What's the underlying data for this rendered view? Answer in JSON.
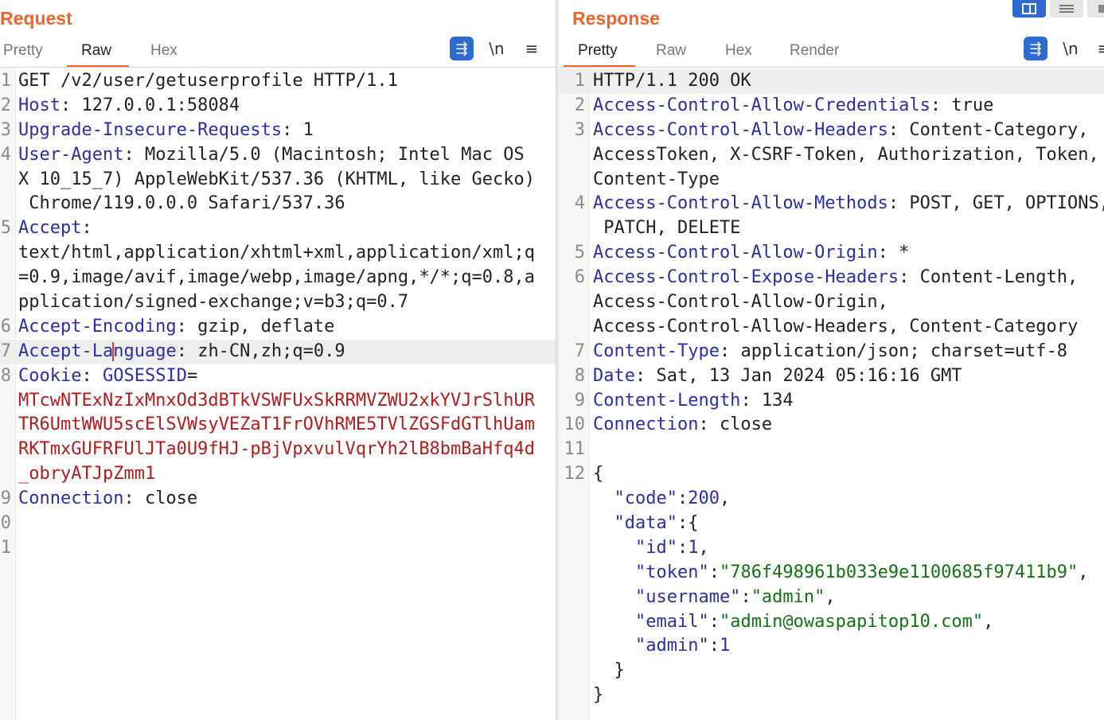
{
  "request": {
    "title": "Request",
    "tabs": [
      "Pretty",
      "Raw",
      "Hex"
    ],
    "active_tab": "Raw",
    "toolbar": {
      "wrap_icon": "wrap-lines-icon",
      "newline_label": "\\n",
      "menu_icon": "hamburger-menu-icon"
    },
    "lines": [
      {
        "no": "1",
        "segs": [
          {
            "t": "GET /v2/user/getuserprofile HTTP/1.1",
            "c": "p"
          }
        ]
      },
      {
        "no": "2",
        "segs": [
          {
            "t": "Host",
            "c": "k"
          },
          {
            "t": ": 127.0.0.1:58084",
            "c": "p"
          }
        ]
      },
      {
        "no": "3",
        "segs": [
          {
            "t": "Upgrade-Insecure-Requests",
            "c": "k"
          },
          {
            "t": ": 1",
            "c": "p"
          }
        ]
      },
      {
        "no": "4",
        "segs": [
          {
            "t": "User-Agent",
            "c": "k"
          },
          {
            "t": ": Mozilla/5.0 (Macintosh; Intel Mac OS",
            "c": "p"
          }
        ]
      },
      {
        "no": "",
        "segs": [
          {
            "t": "X 10_15_7) AppleWebKit/537.36 (KHTML, like Gecko)",
            "c": "p"
          }
        ]
      },
      {
        "no": "",
        "segs": [
          {
            "t": " Chrome/119.0.0.0 Safari/537.36",
            "c": "p"
          }
        ]
      },
      {
        "no": "5",
        "segs": [
          {
            "t": "Accept",
            "c": "k"
          },
          {
            "t": ":",
            "c": "p"
          }
        ]
      },
      {
        "no": "",
        "segs": [
          {
            "t": "text/html,application/xhtml+xml,application/xml;q",
            "c": "p"
          }
        ]
      },
      {
        "no": "",
        "segs": [
          {
            "t": "=0.9,image/avif,image/webp,image/apng,*/*;q=0.8,a",
            "c": "p"
          }
        ]
      },
      {
        "no": "",
        "segs": [
          {
            "t": "pplication/signed-exchange;v=b3;q=0.7",
            "c": "p"
          }
        ]
      },
      {
        "no": "6",
        "segs": [
          {
            "t": "Accept-Encoding",
            "c": "k"
          },
          {
            "t": ": gzip, deflate",
            "c": "p"
          }
        ]
      },
      {
        "no": "7",
        "hl": true,
        "cursor_after": 9,
        "segs": [
          {
            "t": "Accept-Language",
            "c": "k"
          },
          {
            "t": ": zh-CN,zh;q=0.9",
            "c": "p"
          }
        ]
      },
      {
        "no": "8",
        "segs": [
          {
            "t": "Cookie",
            "c": "k"
          },
          {
            "t": ": ",
            "c": "p"
          },
          {
            "t": "GOSESSID",
            "c": "k"
          },
          {
            "t": "=",
            "c": "p"
          }
        ]
      },
      {
        "no": "",
        "segs": [
          {
            "t": "MTcwNTExNzIxMnxOd3dBTkVSWFUxSkRRMVZWU2xkYVJrSlhUR",
            "c": "r"
          }
        ]
      },
      {
        "no": "",
        "segs": [
          {
            "t": "TR6UmtWWU5scElSVWsyVEZaT1FrOVhRME5TVlZGSFdGTlhUam",
            "c": "r"
          }
        ]
      },
      {
        "no": "",
        "segs": [
          {
            "t": "RKTmxGUFRFUlJTa0U9fHJ-pBjVpxvulVqrYh2lB8bmBaHfq4d",
            "c": "r"
          }
        ]
      },
      {
        "no": "",
        "segs": [
          {
            "t": "_obryATJpZmm1",
            "c": "r"
          }
        ]
      },
      {
        "no": "9",
        "segs": [
          {
            "t": "Connection",
            "c": "k"
          },
          {
            "t": ": close",
            "c": "p"
          }
        ]
      },
      {
        "no": "0",
        "segs": []
      },
      {
        "no": "1",
        "segs": []
      }
    ]
  },
  "response": {
    "title": "Response",
    "tabs": [
      "Pretty",
      "Raw",
      "Hex",
      "Render"
    ],
    "active_tab": "Pretty",
    "toolbar": {
      "wrap_icon": "wrap-lines-icon",
      "newline_label": "\\n",
      "menu_icon": "hamburger-menu-icon"
    },
    "lines": [
      {
        "no": "1",
        "hl": true,
        "segs": [
          {
            "t": "HTTP/1.1 200 OK",
            "c": "p"
          }
        ]
      },
      {
        "no": "2",
        "segs": [
          {
            "t": "Access-Control-Allow-Credentials",
            "c": "k"
          },
          {
            "t": ": true",
            "c": "p"
          }
        ]
      },
      {
        "no": "3",
        "segs": [
          {
            "t": "Access-Control-Allow-Headers",
            "c": "k"
          },
          {
            "t": ": Content-Category,",
            "c": "p"
          }
        ]
      },
      {
        "no": "",
        "segs": [
          {
            "t": "AccessToken, X-CSRF-Token, Authorization, Token,",
            "c": "p"
          }
        ]
      },
      {
        "no": "",
        "segs": [
          {
            "t": "Content-Type",
            "c": "p"
          }
        ]
      },
      {
        "no": "4",
        "segs": [
          {
            "t": "Access-Control-Allow-Methods",
            "c": "k"
          },
          {
            "t": ": POST, GET, OPTIONS,",
            "c": "p"
          }
        ]
      },
      {
        "no": "",
        "segs": [
          {
            "t": " PATCH, DELETE",
            "c": "p"
          }
        ]
      },
      {
        "no": "5",
        "segs": [
          {
            "t": "Access-Control-Allow-Origin",
            "c": "k"
          },
          {
            "t": ": *",
            "c": "p"
          }
        ]
      },
      {
        "no": "6",
        "segs": [
          {
            "t": "Access-Control-Expose-Headers",
            "c": "k"
          },
          {
            "t": ": Content-Length,",
            "c": "p"
          }
        ]
      },
      {
        "no": "",
        "segs": [
          {
            "t": "Access-Control-Allow-Origin,",
            "c": "p"
          }
        ]
      },
      {
        "no": "",
        "segs": [
          {
            "t": "Access-Control-Allow-Headers, Content-Category",
            "c": "p"
          }
        ]
      },
      {
        "no": "7",
        "segs": [
          {
            "t": "Content-Type",
            "c": "k"
          },
          {
            "t": ": application/json; charset=utf-8",
            "c": "p"
          }
        ]
      },
      {
        "no": "8",
        "segs": [
          {
            "t": "Date",
            "c": "k"
          },
          {
            "t": ": Sat, 13 Jan 2024 05:16:16 GMT",
            "c": "p"
          }
        ]
      },
      {
        "no": "9",
        "segs": [
          {
            "t": "Content-Length",
            "c": "k"
          },
          {
            "t": ": 134",
            "c": "p"
          }
        ]
      },
      {
        "no": "10",
        "segs": [
          {
            "t": "Connection",
            "c": "k"
          },
          {
            "t": ": close",
            "c": "p"
          }
        ]
      },
      {
        "no": "11",
        "segs": []
      },
      {
        "no": "12",
        "segs": [
          {
            "t": "{",
            "c": "p"
          }
        ]
      },
      {
        "no": "",
        "segs": [
          {
            "t": "  \"code\"",
            "c": "k"
          },
          {
            "t": ":",
            "c": "p"
          },
          {
            "t": "200",
            "c": "n"
          },
          {
            "t": ",",
            "c": "p"
          }
        ]
      },
      {
        "no": "",
        "segs": [
          {
            "t": "  \"data\"",
            "c": "k"
          },
          {
            "t": ":{",
            "c": "p"
          }
        ]
      },
      {
        "no": "",
        "segs": [
          {
            "t": "    \"id\"",
            "c": "k"
          },
          {
            "t": ":",
            "c": "p"
          },
          {
            "t": "1",
            "c": "n"
          },
          {
            "t": ",",
            "c": "p"
          }
        ]
      },
      {
        "no": "",
        "segs": [
          {
            "t": "    \"token\"",
            "c": "k"
          },
          {
            "t": ":",
            "c": "p"
          },
          {
            "t": "\"786f498961b033e9e1100685f97411b9\"",
            "c": "s"
          },
          {
            "t": ",",
            "c": "p"
          }
        ]
      },
      {
        "no": "",
        "segs": [
          {
            "t": "    \"username\"",
            "c": "k"
          },
          {
            "t": ":",
            "c": "p"
          },
          {
            "t": "\"admin\"",
            "c": "s"
          },
          {
            "t": ",",
            "c": "p"
          }
        ]
      },
      {
        "no": "",
        "segs": [
          {
            "t": "    \"email\"",
            "c": "k"
          },
          {
            "t": ":",
            "c": "p"
          },
          {
            "t": "\"admin@owaspapitop10.com\"",
            "c": "s"
          },
          {
            "t": ",",
            "c": "p"
          }
        ]
      },
      {
        "no": "",
        "segs": [
          {
            "t": "    \"admin\"",
            "c": "k"
          },
          {
            "t": ":",
            "c": "p"
          },
          {
            "t": "1",
            "c": "n"
          }
        ]
      },
      {
        "no": "",
        "segs": [
          {
            "t": "  }",
            "c": "p"
          }
        ]
      },
      {
        "no": "",
        "segs": [
          {
            "t": "}",
            "c": "p"
          }
        ]
      }
    ]
  },
  "view_buttons": [
    {
      "icon": "split-view-icon",
      "active": true
    },
    {
      "icon": "stacked-view-icon",
      "active": false
    },
    {
      "icon": "single-pane-icon",
      "active": false
    }
  ],
  "colors": {
    "accent": "#f0642a",
    "key": "#2a2fa8",
    "cookie": "#b51b1b",
    "string": "#117411",
    "button": "#2d6bd1"
  }
}
